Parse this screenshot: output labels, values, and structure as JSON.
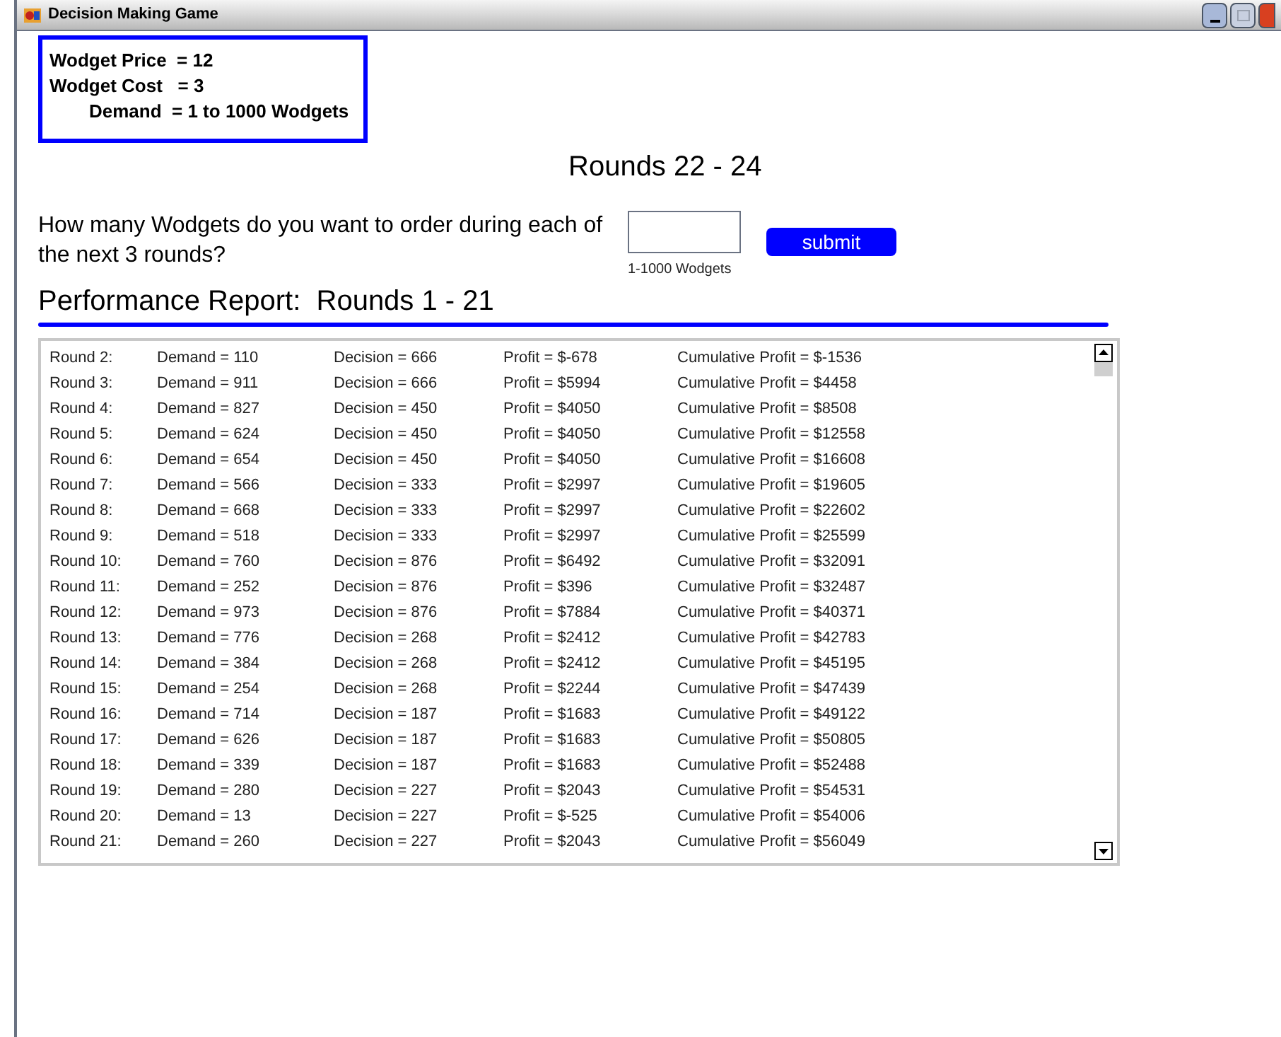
{
  "window": {
    "title": "Decision Making Game"
  },
  "parameters": [
    "Wodget Price  = 12",
    "Wodget Cost   = 3",
    "Demand  = 1 to 1000 Wodgets"
  ],
  "rounds_heading": "Rounds 22 - 24",
  "question": "How many Wodgets do you want to order during each of the next 3 rounds?",
  "order_field": {
    "hint": "1-1000 Wodgets"
  },
  "submit_button": "submit",
  "report_title": "Performance Report:  Rounds 1 - 21",
  "report_rows": [
    {
      "round": "Round 2:",
      "demand": "Demand = 110",
      "decision": "Decision = 666",
      "profit": "Profit = $-678",
      "cumulative": "Cumulative Profit = $-1536"
    },
    {
      "round": "Round 3:",
      "demand": "Demand = 911",
      "decision": "Decision = 666",
      "profit": "Profit = $5994",
      "cumulative": "Cumulative Profit = $4458"
    },
    {
      "round": "Round 4:",
      "demand": "Demand = 827",
      "decision": "Decision = 450",
      "profit": "Profit = $4050",
      "cumulative": "Cumulative Profit = $8508"
    },
    {
      "round": "Round 5:",
      "demand": "Demand = 624",
      "decision": "Decision = 450",
      "profit": "Profit = $4050",
      "cumulative": "Cumulative Profit = $12558"
    },
    {
      "round": "Round 6:",
      "demand": "Demand = 654",
      "decision": "Decision = 450",
      "profit": "Profit = $4050",
      "cumulative": "Cumulative Profit = $16608"
    },
    {
      "round": "Round 7:",
      "demand": "Demand = 566",
      "decision": "Decision = 333",
      "profit": "Profit = $2997",
      "cumulative": "Cumulative Profit = $19605"
    },
    {
      "round": "Round 8:",
      "demand": "Demand = 668",
      "decision": "Decision = 333",
      "profit": "Profit = $2997",
      "cumulative": "Cumulative Profit = $22602"
    },
    {
      "round": "Round 9:",
      "demand": "Demand = 518",
      "decision": "Decision = 333",
      "profit": "Profit = $2997",
      "cumulative": "Cumulative Profit = $25599"
    },
    {
      "round": "Round 10:",
      "demand": "Demand = 760",
      "decision": "Decision = 876",
      "profit": "Profit = $6492",
      "cumulative": "Cumulative Profit = $32091"
    },
    {
      "round": "Round 11:",
      "demand": "Demand = 252",
      "decision": "Decision = 876",
      "profit": "Profit = $396",
      "cumulative": "Cumulative Profit = $32487"
    },
    {
      "round": "Round 12:",
      "demand": "Demand = 973",
      "decision": "Decision = 876",
      "profit": "Profit = $7884",
      "cumulative": "Cumulative Profit = $40371"
    },
    {
      "round": "Round 13:",
      "demand": "Demand = 776",
      "decision": "Decision = 268",
      "profit": "Profit = $2412",
      "cumulative": "Cumulative Profit = $42783"
    },
    {
      "round": "Round 14:",
      "demand": "Demand = 384",
      "decision": "Decision = 268",
      "profit": "Profit = $2412",
      "cumulative": "Cumulative Profit = $45195"
    },
    {
      "round": "Round 15:",
      "demand": "Demand = 254",
      "decision": "Decision = 268",
      "profit": "Profit = $2244",
      "cumulative": "Cumulative Profit = $47439"
    },
    {
      "round": "Round 16:",
      "demand": "Demand = 714",
      "decision": "Decision = 187",
      "profit": "Profit = $1683",
      "cumulative": "Cumulative Profit = $49122"
    },
    {
      "round": "Round 17:",
      "demand": "Demand = 626",
      "decision": "Decision = 187",
      "profit": "Profit = $1683",
      "cumulative": "Cumulative Profit = $50805"
    },
    {
      "round": "Round 18:",
      "demand": "Demand = 339",
      "decision": "Decision = 187",
      "profit": "Profit = $1683",
      "cumulative": "Cumulative Profit = $52488"
    },
    {
      "round": "Round 19:",
      "demand": "Demand = 280",
      "decision": "Decision = 227",
      "profit": "Profit = $2043",
      "cumulative": "Cumulative Profit = $54531"
    },
    {
      "round": "Round 20:",
      "demand": "Demand = 13",
      "decision": "Decision = 227",
      "profit": "Profit = $-525",
      "cumulative": "Cumulative Profit = $54006"
    },
    {
      "round": "Round 21:",
      "demand": "Demand = 260",
      "decision": "Decision = 227",
      "profit": "Profit = $2043",
      "cumulative": "Cumulative Profit = $56049"
    }
  ]
}
